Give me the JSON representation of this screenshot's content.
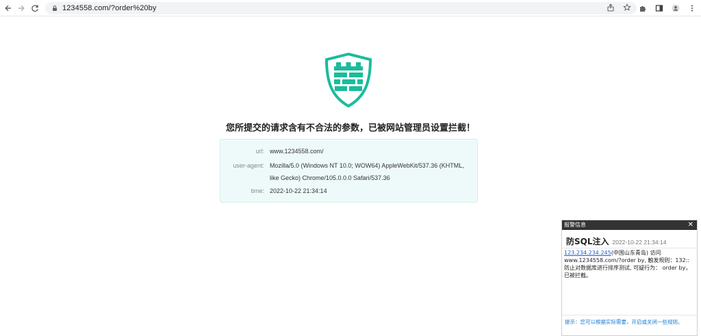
{
  "browser": {
    "address": "1234558.com/?order%20by",
    "icons": {
      "back": "arrow-left-icon",
      "forward": "arrow-right-icon",
      "reload": "reload-icon",
      "lock": "lock-icon",
      "share": "share-icon",
      "bookmark": "star-icon",
      "extensions": "puzzle-icon",
      "sidepanel": "side-panel-icon",
      "profile": "avatar-icon",
      "menu": "kebab-menu-icon"
    }
  },
  "page": {
    "headline": "您所提交的请求含有不合法的参数，已被网站管理员设置拦截！",
    "shield_color": "#1abc9c",
    "info": {
      "url_label": "url:",
      "url_value": "www.1234558.com/",
      "ua_label": "user-agent:",
      "ua_value": "Mozilla/5.0 (Windows NT 10.0; WOW64) AppleWebKit/537.36 (KHTML, like Gecko) Chrome/105.0.0.0 Safari/537.36",
      "time_label": "time:",
      "time_value": "2022-10-22 21:34:14"
    }
  },
  "alert": {
    "header": "报警信息",
    "close": "✕",
    "title": "防SQL注入",
    "time": "2022-10-22 21:34:14",
    "ip_link": "123.234.234.245",
    "body_rest": "(中国山东青岛) 访问www.1234558.com/?order by, 触发规则：132::防止对数据库进行排序测试, 可疑行为： order by，已被拦截。",
    "footer": "提示：您可以根据实际需要，开启或关闭一些规则。"
  }
}
